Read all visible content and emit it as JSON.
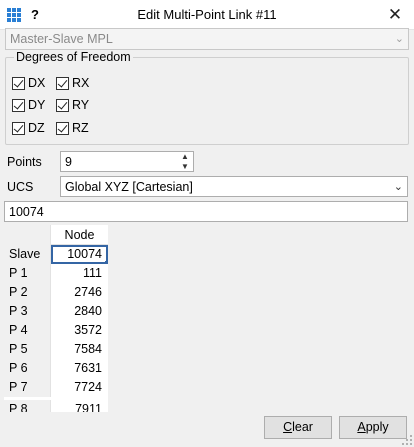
{
  "window": {
    "title": "Edit Multi-Point Link #11",
    "help_label": "?",
    "close_label": "✕"
  },
  "type_combo": {
    "value": "Master-Slave MPL"
  },
  "dof": {
    "legend": "Degrees of Freedom",
    "items": [
      {
        "label": "DX",
        "checked": true
      },
      {
        "label": "RX",
        "checked": true
      },
      {
        "label": "DY",
        "checked": true
      },
      {
        "label": "RY",
        "checked": true
      },
      {
        "label": "DZ",
        "checked": true
      },
      {
        "label": "RZ",
        "checked": true
      }
    ]
  },
  "points": {
    "label": "Points",
    "value": "9"
  },
  "ucs": {
    "label": "UCS",
    "value": "Global XYZ [Cartesian]"
  },
  "node_field": {
    "value": "10074"
  },
  "table": {
    "column_header": "Node",
    "rows": [
      {
        "header": "Slave",
        "value": "10074"
      },
      {
        "header": "P 1",
        "value": "111"
      },
      {
        "header": "P 2",
        "value": "2746"
      },
      {
        "header": "P 3",
        "value": "2840"
      },
      {
        "header": "P 4",
        "value": "3572"
      },
      {
        "header": "P 5",
        "value": "7584"
      },
      {
        "header": "P 6",
        "value": "7631"
      },
      {
        "header": "P 7",
        "value": "7724"
      },
      {
        "header": "P 8",
        "value": "7911"
      }
    ]
  },
  "buttons": {
    "clear": {
      "mnemonic": "C",
      "rest": "lear"
    },
    "apply": {
      "mnemonic": "A",
      "rest": "pply"
    }
  }
}
